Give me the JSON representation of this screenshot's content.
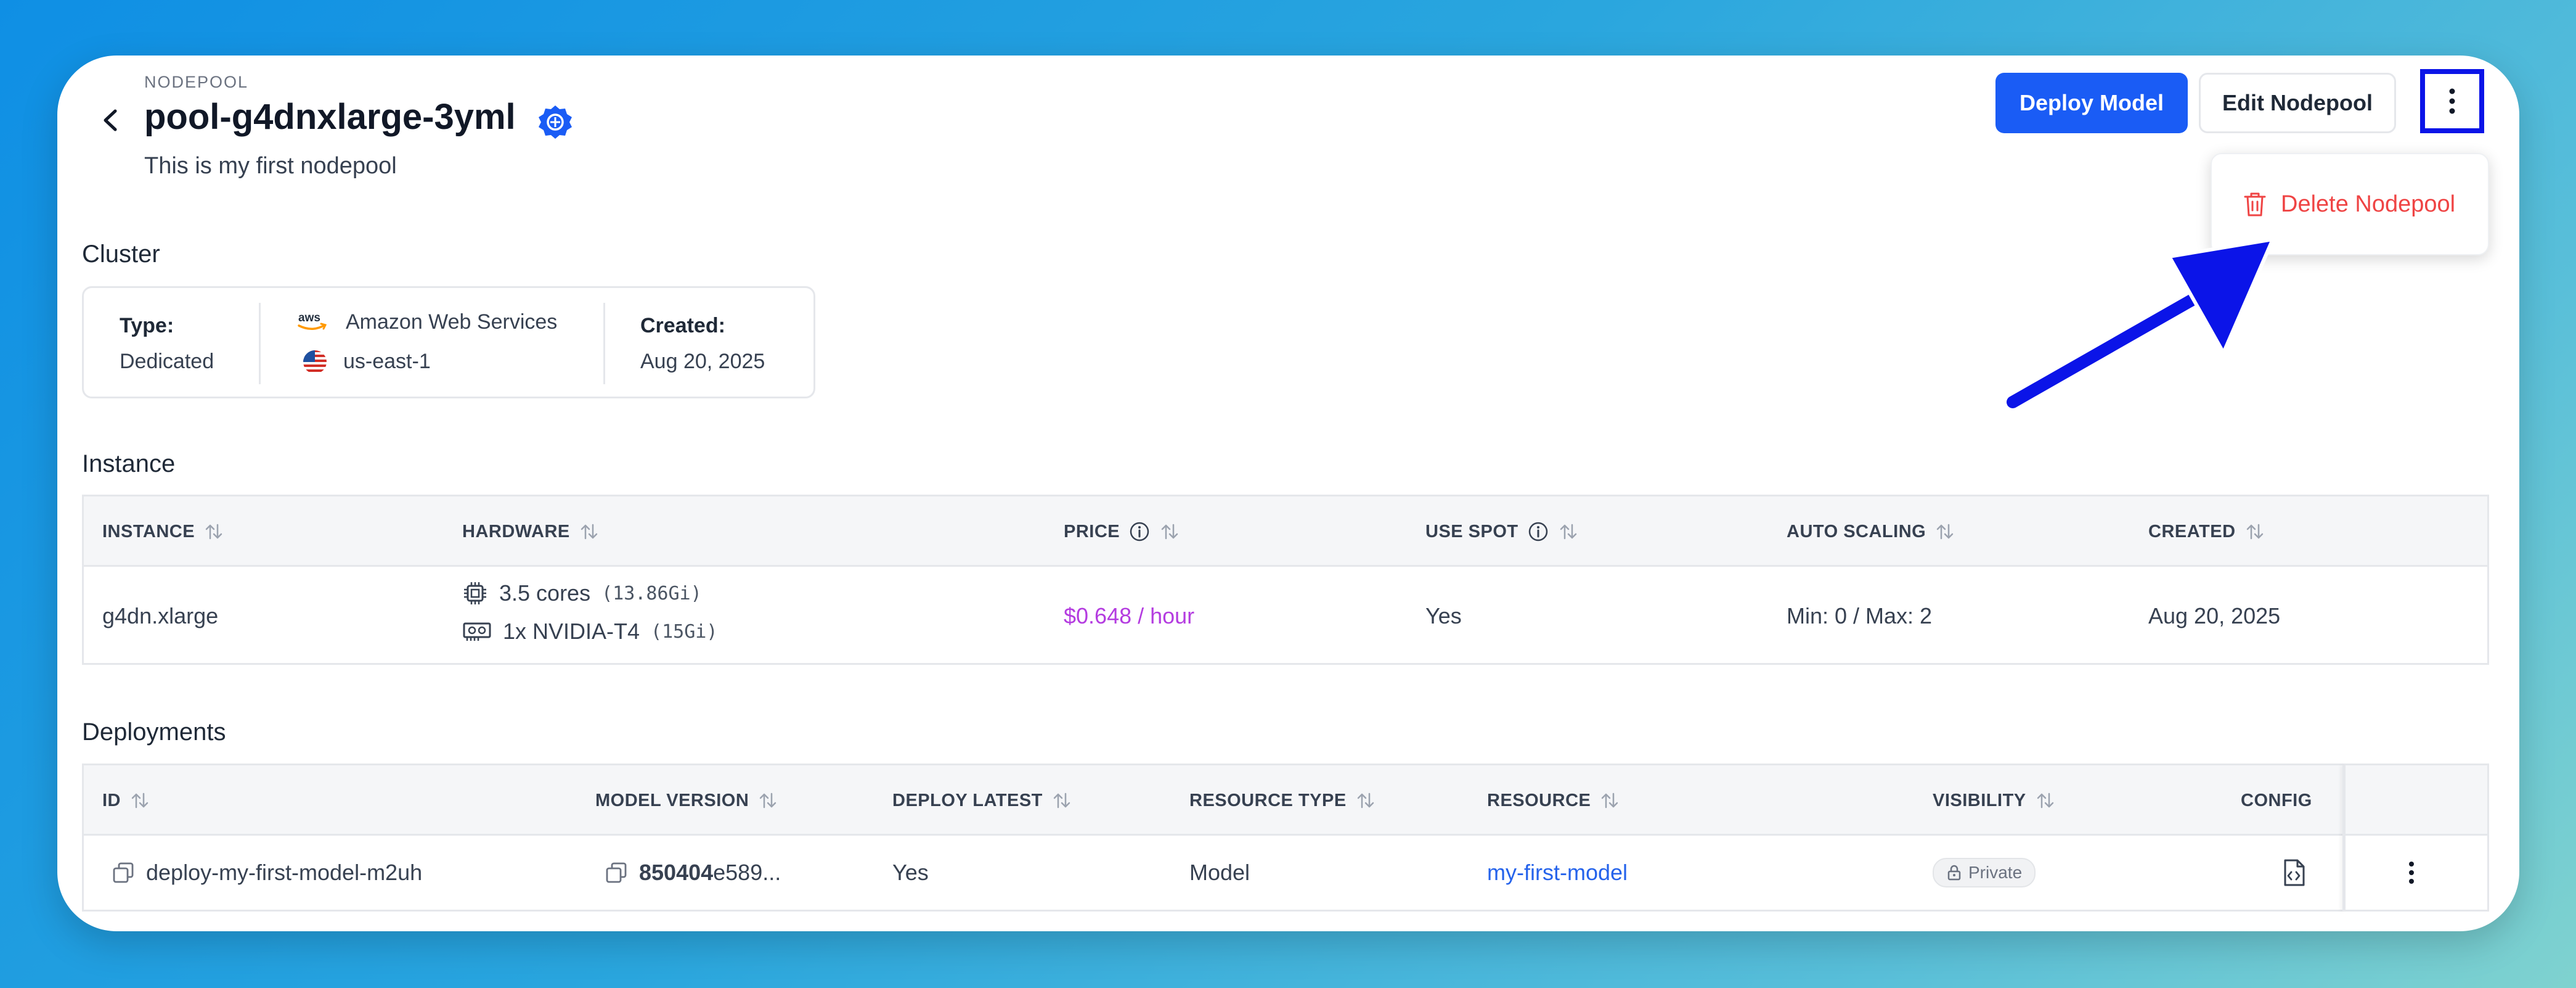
{
  "header": {
    "eyebrow": "NODEPOOL",
    "title": "pool-g4dnxlarge-3yml",
    "subtitle": "This is my first nodepool"
  },
  "actions": {
    "deploy_label": "Deploy Model",
    "edit_label": "Edit Nodepool",
    "more_icon": "kebab-vertical-icon"
  },
  "dropdown": {
    "delete_label": "Delete Nodepool",
    "icon": "trash-icon"
  },
  "cluster": {
    "section_title": "Cluster",
    "type_label": "Type:",
    "type_value": "Dedicated",
    "provider": "Amazon Web Services",
    "region": "us-east-1",
    "created_label": "Created:",
    "created_value": "Aug 20, 2025"
  },
  "instance": {
    "section_title": "Instance",
    "columns": [
      "INSTANCE",
      "HARDWARE",
      "PRICE",
      "USE SPOT",
      "AUTO SCALING",
      "CREATED"
    ],
    "row": {
      "instance": "g4dn.xlarge",
      "cpu": "3.5 cores",
      "cpu_mem": "(13.86Gi)",
      "gpu": "1x NVIDIA-T4",
      "gpu_mem": "(15Gi)",
      "price": "$0.648 / hour",
      "use_spot": "Yes",
      "auto_scaling": "Min: 0 / Max: 2",
      "created": "Aug 20, 2025"
    }
  },
  "deployments": {
    "section_title": "Deployments",
    "columns": [
      "ID",
      "MODEL VERSION",
      "DEPLOY LATEST",
      "RESOURCE TYPE",
      "RESOURCE",
      "VISIBILITY",
      "CONFIG"
    ],
    "row": {
      "id": "deploy-my-first-model-m2uh",
      "model_version_bold": "850404",
      "model_version_rest": "e589...",
      "deploy_latest": "Yes",
      "resource_type": "Model",
      "resource": "my-first-model",
      "visibility": "Private"
    }
  },
  "colors": {
    "primary": "#1a5cf5",
    "danger": "#ef4444",
    "price": "#b43ce0",
    "link": "#2563eb",
    "highlight": "#0b14e8"
  }
}
